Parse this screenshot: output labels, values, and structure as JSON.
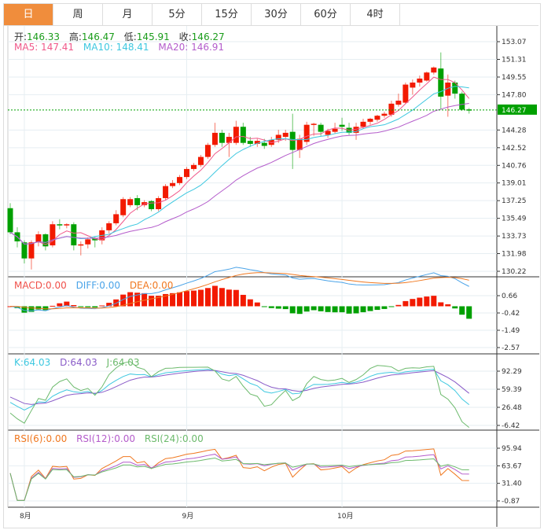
{
  "tabs": [
    "日",
    "周",
    "月",
    "5分",
    "15分",
    "30分",
    "60分",
    "4时"
  ],
  "active_tab": 0,
  "ohlc": {
    "open_label": "开:",
    "open": "146.33",
    "high_label": "高:",
    "high": "146.47",
    "low_label": "低:",
    "low": "145.91",
    "close_label": "收:",
    "close": "146.27"
  },
  "ma": {
    "ma5": "MA5: 147.41",
    "ma10": "MA10: 148.41",
    "ma20": "MA20: 146.91"
  },
  "macd_legend": {
    "macd": "MACD:0.00",
    "diff": "DIFF:0.00",
    "dea": "DEA:0.00"
  },
  "kdj_legend": {
    "k": "K:64.03",
    "d": "D:64.03",
    "j": "J:64.03"
  },
  "rsi_legend": {
    "rsi6": "RSI(6):0.00",
    "rsi12": "RSI(12):0.00",
    "rsi24": "RSI(24):0.00"
  },
  "current_price": "146.27",
  "colors": {
    "up": "#f21a00",
    "down": "#00a000",
    "ma5": "#f0588a",
    "ma10": "#3ec8e0",
    "ma20": "#b45ccb",
    "accent": "#f08d3c",
    "price_tag": "#00a000"
  },
  "chart_data": {
    "type": "candlestick",
    "price_axis_ticks": [
      "153.07",
      "151.31",
      "149.55",
      "147.80",
      "144.28",
      "142.52",
      "140.76",
      "139.01",
      "137.25",
      "135.49",
      "133.73",
      "131.98",
      "130.22"
    ],
    "macd_axis_ticks": [
      "0.66",
      "-0.42",
      "-1.49",
      "-2.57"
    ],
    "kdj_axis_ticks": [
      "92.29",
      "59.39",
      "26.48",
      "-6.42"
    ],
    "rsi_axis_ticks": [
      "95.94",
      "63.67",
      "31.40",
      "-0.87"
    ],
    "x_labels": [
      {
        "label": "8月",
        "index": 2
      },
      {
        "label": "9月",
        "index": 25
      },
      {
        "label": "10月",
        "index": 47
      }
    ],
    "grid": true,
    "candles": [
      [
        136.5,
        137.0,
        133.9,
        134.1
      ],
      [
        134.1,
        134.6,
        132.6,
        133.2
      ],
      [
        133.1,
        133.3,
        131.0,
        131.5
      ],
      [
        131.5,
        133.3,
        130.4,
        133.1
      ],
      [
        133.1,
        134.2,
        132.7,
        133.9
      ],
      [
        133.9,
        134.0,
        132.3,
        132.7
      ],
      [
        132.8,
        135.2,
        132.6,
        134.9
      ],
      [
        134.9,
        135.4,
        134.4,
        134.8
      ],
      [
        134.8,
        135.0,
        134.5,
        134.9
      ],
      [
        134.9,
        135.1,
        132.3,
        132.8
      ],
      [
        132.8,
        133.2,
        131.8,
        132.9
      ],
      [
        132.9,
        133.6,
        132.5,
        133.4
      ],
      [
        133.5,
        133.7,
        132.6,
        133.3
      ],
      [
        133.3,
        134.6,
        132.9,
        134.3
      ],
      [
        134.3,
        135.2,
        134.0,
        135.0
      ],
      [
        135.0,
        136.3,
        134.8,
        135.9
      ],
      [
        135.8,
        137.6,
        135.6,
        137.4
      ],
      [
        136.8,
        137.6,
        136.6,
        137.4
      ],
      [
        137.5,
        137.8,
        136.3,
        136.8
      ],
      [
        136.8,
        137.3,
        136.6,
        137.1
      ],
      [
        137.2,
        137.3,
        136.2,
        136.4
      ],
      [
        136.4,
        137.7,
        136.2,
        137.5
      ],
      [
        137.5,
        138.9,
        137.3,
        138.7
      ],
      [
        138.7,
        139.3,
        138.5,
        139.0
      ],
      [
        139.0,
        139.8,
        138.8,
        139.6
      ],
      [
        139.6,
        140.6,
        139.4,
        140.4
      ],
      [
        140.4,
        141.0,
        140.2,
        140.8
      ],
      [
        140.8,
        141.8,
        140.6,
        141.6
      ],
      [
        141.6,
        143.0,
        141.4,
        142.8
      ],
      [
        142.8,
        145.0,
        142.6,
        144.0
      ],
      [
        144.0,
        144.3,
        142.6,
        143.0
      ],
      [
        143.0,
        144.0,
        141.6,
        143.6
      ],
      [
        143.0,
        145.2,
        142.8,
        144.6
      ],
      [
        144.6,
        145.0,
        142.8,
        143.0
      ],
      [
        143.2,
        143.6,
        142.6,
        142.9
      ],
      [
        142.9,
        143.4,
        142.6,
        143.2
      ],
      [
        143.0,
        143.4,
        142.4,
        142.7
      ],
      [
        142.8,
        143.6,
        142.6,
        143.3
      ],
      [
        143.3,
        144.3,
        143.0,
        143.8
      ],
      [
        143.6,
        144.3,
        143.2,
        144.0
      ],
      [
        144.1,
        145.9,
        140.4,
        142.3
      ],
      [
        142.3,
        143.8,
        141.5,
        143.4
      ],
      [
        143.1,
        145.1,
        142.8,
        144.8
      ],
      [
        144.8,
        145.0,
        143.7,
        144.9
      ],
      [
        144.8,
        145.0,
        143.7,
        144.1
      ],
      [
        143.8,
        144.4,
        143.5,
        144.2
      ],
      [
        144.1,
        145.0,
        143.9,
        144.4
      ],
      [
        144.8,
        145.5,
        144.2,
        144.6
      ],
      [
        144.5,
        145.0,
        143.8,
        144.0
      ],
      [
        144.0,
        145.0,
        143.3,
        144.6
      ],
      [
        144.6,
        145.4,
        144.4,
        145.1
      ],
      [
        145.1,
        145.5,
        144.8,
        145.4
      ],
      [
        145.3,
        145.8,
        145.1,
        145.7
      ],
      [
        145.7,
        146.1,
        145.5,
        145.9
      ],
      [
        145.8,
        147.2,
        145.6,
        146.9
      ],
      [
        146.8,
        147.9,
        146.6,
        147.2
      ],
      [
        147.0,
        149.0,
        146.9,
        148.8
      ],
      [
        148.5,
        149.3,
        147.8,
        149.0
      ],
      [
        149.0,
        149.7,
        148.6,
        149.4
      ],
      [
        149.2,
        150.1,
        149.1,
        150.0
      ],
      [
        150.0,
        150.6,
        149.8,
        150.5
      ],
      [
        150.4,
        152.0,
        146.3,
        147.6
      ],
      [
        147.7,
        149.8,
        145.6,
        149.0
      ],
      [
        149.0,
        149.2,
        147.4,
        147.9
      ],
      [
        147.9,
        148.1,
        146.2,
        146.3
      ],
      [
        146.33,
        146.47,
        145.91,
        146.27
      ]
    ]
  }
}
